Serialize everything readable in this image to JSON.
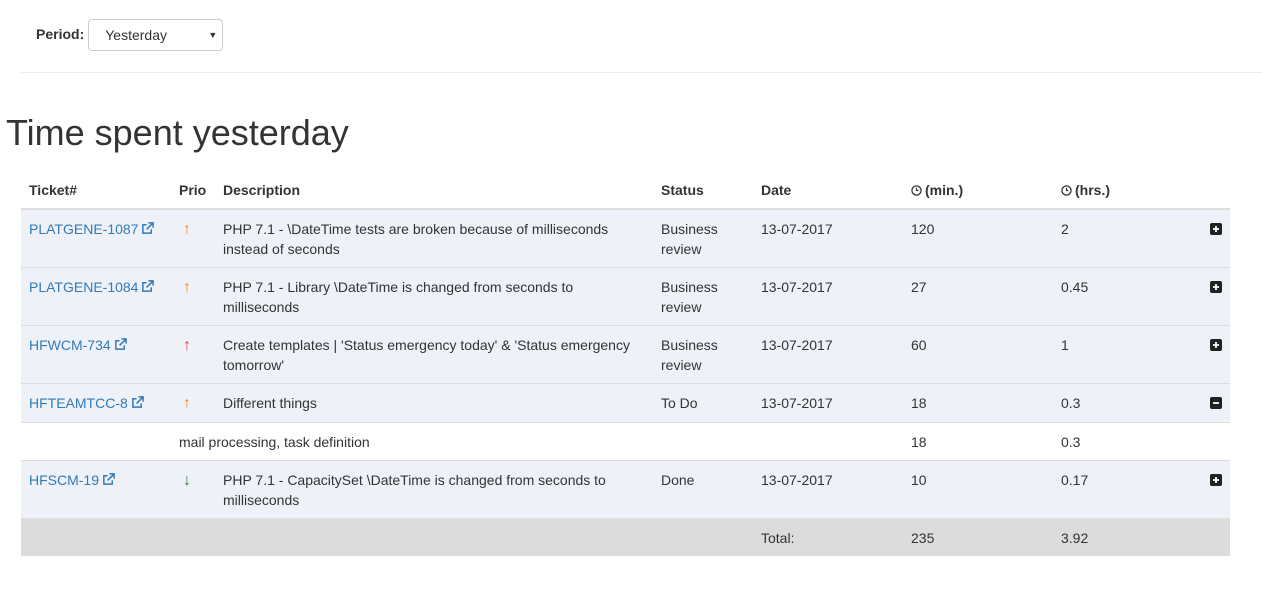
{
  "filter": {
    "label": "Period:",
    "selected": "Yesterday"
  },
  "title": "Time spent yesterday",
  "columns": {
    "ticket": "Ticket#",
    "prio": "Prio",
    "description": "Description",
    "status": "Status",
    "date": "Date",
    "minutes": "(min.)",
    "hours": "(hrs.)"
  },
  "rows": [
    {
      "ticket": "PLATGENE-1087",
      "prio": "up",
      "description": "PHP 7.1 - \\DateTime tests are broken because of milliseconds instead of seconds",
      "status": "Business review",
      "date": "13-07-2017",
      "minutes": "120",
      "hours": "2",
      "expanded": false
    },
    {
      "ticket": "PLATGENE-1084",
      "prio": "up",
      "description": "PHP 7.1 - Library \\DateTime is changed from seconds to milliseconds",
      "status": "Business review",
      "date": "13-07-2017",
      "minutes": "27",
      "hours": "0.45",
      "expanded": false
    },
    {
      "ticket": "HFWCM-734",
      "prio": "up-red",
      "description": "Create templates | 'Status emergency today' & 'Status emergency tomorrow'",
      "status": "Business review",
      "date": "13-07-2017",
      "minutes": "60",
      "hours": "1",
      "expanded": false
    },
    {
      "ticket": "HFTEAMTCC-8",
      "prio": "up",
      "description": "Different things",
      "status": "To Do",
      "date": "13-07-2017",
      "minutes": "18",
      "hours": "0.3",
      "expanded": true
    },
    {
      "ticket": "HFSCM-19",
      "prio": "down",
      "description": "PHP 7.1 - CapacitySet \\DateTime is changed from seconds to milliseconds",
      "status": "Done",
      "date": "13-07-2017",
      "minutes": "10",
      "hours": "0.17",
      "expanded": false
    }
  ],
  "detail": {
    "text": "mail processing, task definition",
    "minutes": "18",
    "hours": "0.3"
  },
  "total": {
    "label": "Total:",
    "minutes": "235",
    "hours": "3.92"
  },
  "colors": {
    "prio_orange": "#f0892c",
    "prio_red": "#e0424a",
    "prio_green": "#2e8b3e",
    "link": "#337ab7"
  }
}
